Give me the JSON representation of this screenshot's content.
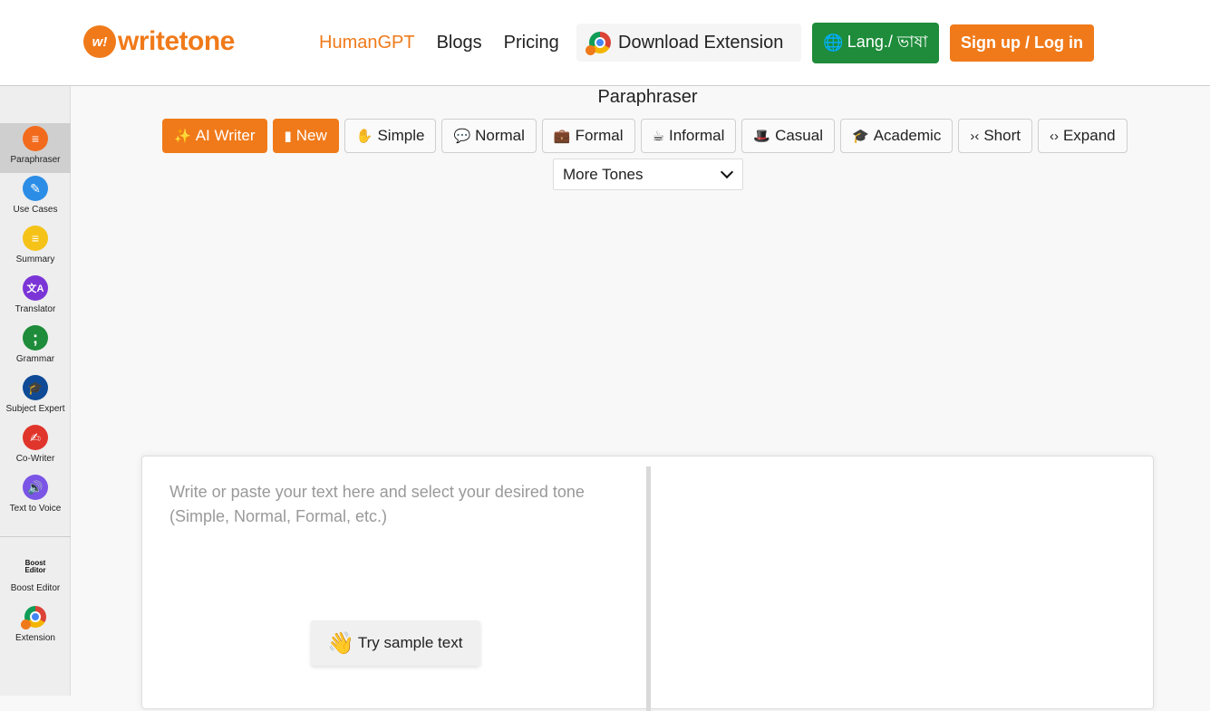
{
  "header": {
    "logo_badge": "w!",
    "logo_text": "writetone",
    "nav": [
      {
        "label": "HumanGPT",
        "active": true
      },
      {
        "label": "Blogs",
        "active": false
      },
      {
        "label": "Pricing",
        "active": false
      }
    ],
    "download_extension": "Download Extension",
    "lang_button": "Lang./ ভাষা",
    "signup_button": "Sign up / Log in"
  },
  "sidebar": {
    "items": [
      {
        "label": "Paraphraser",
        "icon": "paraphraser-icon",
        "color": "#f26b1d",
        "active": true
      },
      {
        "label": "Use Cases",
        "icon": "pencil-icon",
        "color": "#2b8de6"
      },
      {
        "label": "Summary",
        "icon": "lines-icon",
        "color": "#f5c218"
      },
      {
        "label": "Translator",
        "icon": "translate-icon",
        "color": "#7b35d6"
      },
      {
        "label": "Grammar",
        "icon": "semicolon-icon",
        "color": "#1e8c3a"
      },
      {
        "label": "Subject Expert",
        "icon": "graduation-cap-icon",
        "color": "#0e4a96"
      },
      {
        "label": "Co-Writer",
        "icon": "hand-writing-icon",
        "color": "#e0352b"
      },
      {
        "label": "Text to Voice",
        "icon": "speaker-icon",
        "color": "#7a55e6"
      }
    ],
    "bottom_items": [
      {
        "label": "Boost Editor",
        "icon": "boost-editor-icon",
        "icon_text": "Boost Editor"
      },
      {
        "label": "Extension",
        "icon": "chrome-icon"
      }
    ]
  },
  "main": {
    "title": "Paraphraser",
    "tones": [
      {
        "label": "AI Writer",
        "icon": "magic-wand-icon",
        "glyph": "✨",
        "primary": true
      },
      {
        "label": "New",
        "icon": "file-icon",
        "glyph": "📄",
        "primary": true
      },
      {
        "label": "Simple",
        "icon": "hand-sparkle-icon",
        "glyph": "✋"
      },
      {
        "label": "Normal",
        "icon": "comment-icon",
        "glyph": "💬"
      },
      {
        "label": "Formal",
        "icon": "briefcase-icon",
        "glyph": "💼"
      },
      {
        "label": "Informal",
        "icon": "mug-icon",
        "glyph": "☕"
      },
      {
        "label": "Casual",
        "icon": "hat-icon",
        "glyph": "🎩"
      },
      {
        "label": "Academic",
        "icon": "graduation-cap-icon",
        "glyph": "🎓"
      },
      {
        "label": "Short",
        "icon": "compress-icon",
        "glyph": "›‹"
      },
      {
        "label": "Expand",
        "icon": "expand-icon",
        "glyph": "‹›"
      }
    ],
    "more_tones": "More Tones",
    "editor": {
      "placeholder": "Write or paste your text here and select your desired tone (Simple, Normal, Formal, etc.)",
      "input_value": "",
      "output_value": "",
      "sample_button": "Try sample text"
    }
  }
}
